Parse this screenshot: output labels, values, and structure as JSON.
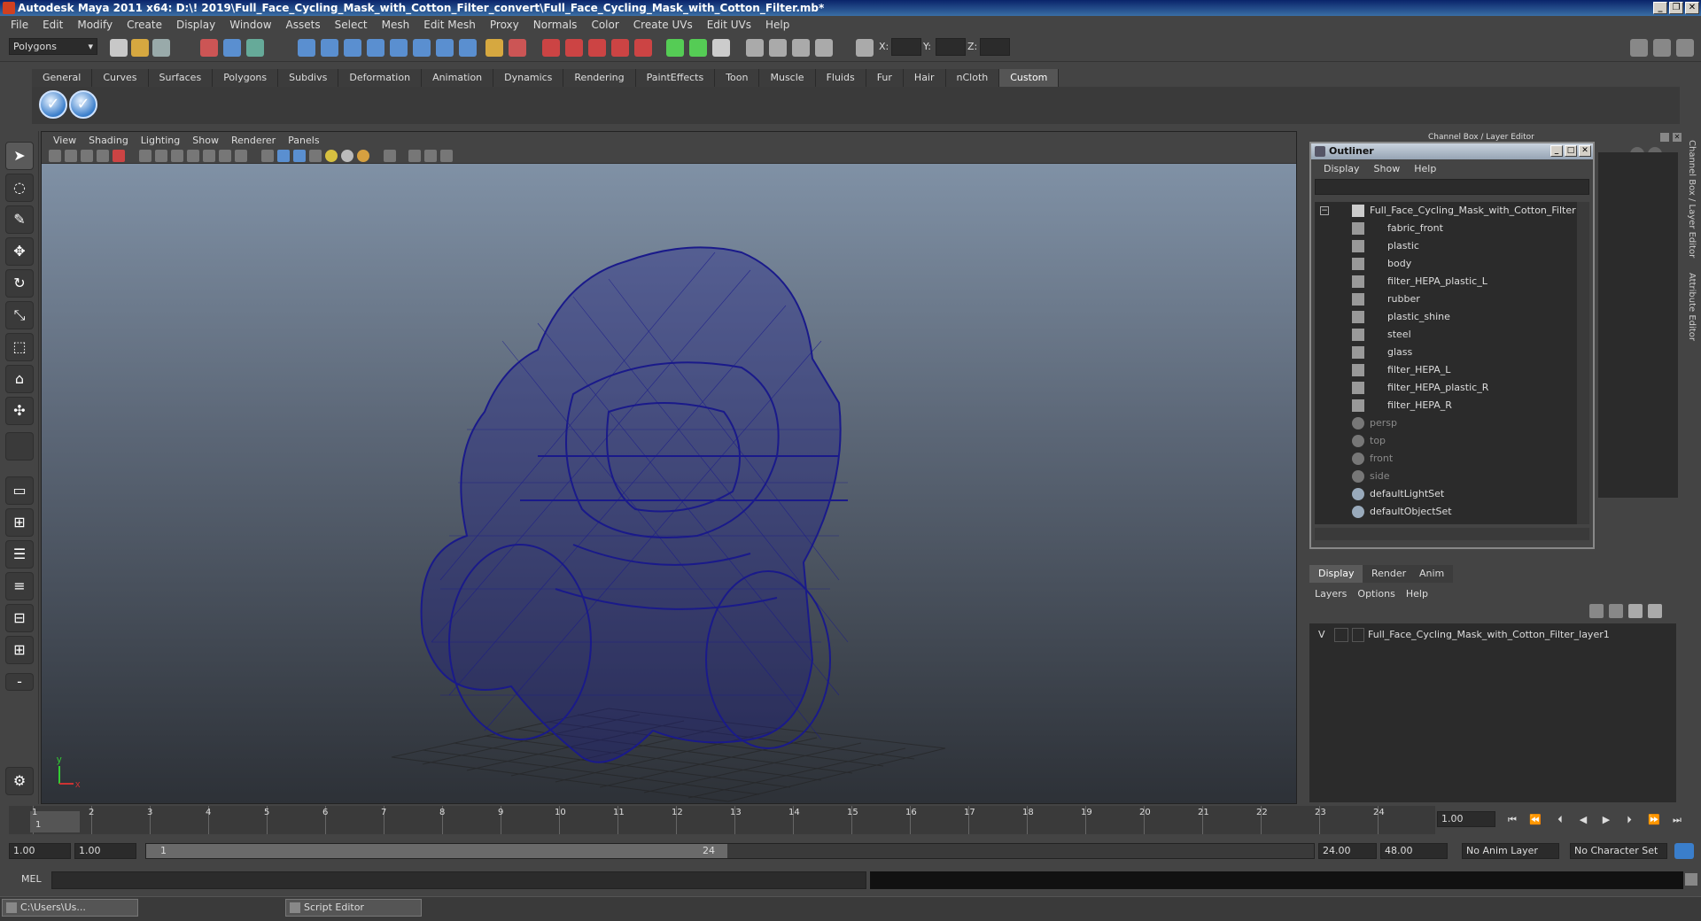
{
  "window": {
    "title": "Autodesk Maya 2011 x64: D:\\! 2019\\Full_Face_Cycling_Mask_with_Cotton_Filter_convert\\Full_Face_Cycling_Mask_with_Cotton_Filter.mb*"
  },
  "menubar": [
    "File",
    "Edit",
    "Modify",
    "Create",
    "Display",
    "Window",
    "Assets",
    "Select",
    "Mesh",
    "Edit Mesh",
    "Proxy",
    "Normals",
    "Color",
    "Create UVs",
    "Edit UVs",
    "Help"
  ],
  "statusline": {
    "mode": "Polygons",
    "x_label": "X:",
    "y_label": "Y:",
    "z_label": "Z:"
  },
  "shelf": {
    "tabs": [
      "General",
      "Curves",
      "Surfaces",
      "Polygons",
      "Subdivs",
      "Deformation",
      "Animation",
      "Dynamics",
      "Rendering",
      "PaintEffects",
      "Toon",
      "Muscle",
      "Fluids",
      "Fur",
      "Hair",
      "nCloth",
      "Custom"
    ],
    "active_tab": "Custom"
  },
  "viewport": {
    "menu": [
      "View",
      "Shading",
      "Lighting",
      "Show",
      "Renderer",
      "Panels"
    ],
    "axis_x": "x",
    "axis_y": "y"
  },
  "channelbox": {
    "title": "Channel Box / Layer Editor",
    "side_tabs": [
      "Channel Box / Layer Editor",
      "Attribute Editor"
    ]
  },
  "outliner": {
    "title": "Outliner",
    "menu": [
      "Display",
      "Show",
      "Help"
    ],
    "root": "Full_Face_Cycling_Mask_with_Cotton_Filter",
    "children": [
      "fabric_front",
      "plastic",
      "body",
      "filter_HEPA_plastic_L",
      "rubber",
      "plastic_shine",
      "steel",
      "glass",
      "filter_HEPA_L",
      "filter_HEPA_plastic_R",
      "filter_HEPA_R"
    ],
    "cameras": [
      "persp",
      "top",
      "front",
      "side"
    ],
    "sets": [
      "defaultLightSet",
      "defaultObjectSet"
    ]
  },
  "layer_editor": {
    "tabs": [
      "Display",
      "Render",
      "Anim"
    ],
    "active_tab": "Display",
    "menu": [
      "Layers",
      "Options",
      "Help"
    ],
    "layer_visible": "V",
    "layer_name": "Full_Face_Cycling_Mask_with_Cotton_Filter_layer1"
  },
  "timeline": {
    "ticks": [
      "1",
      "2",
      "3",
      "4",
      "5",
      "6",
      "7",
      "8",
      "9",
      "10",
      "11",
      "12",
      "13",
      "14",
      "15",
      "16",
      "17",
      "18",
      "19",
      "20",
      "21",
      "22",
      "23",
      "24"
    ],
    "current_frame_marker": "1",
    "current_frame": "1.00"
  },
  "range": {
    "start": "1.00",
    "playback_start": "1.00",
    "slider_start": "1",
    "slider_end": "24",
    "playback_end": "24.00",
    "end": "48.00",
    "anim_layer": "No Anim Layer",
    "character_set": "No Character Set"
  },
  "command": {
    "label": "MEL"
  },
  "taskbar": {
    "item1": "C:\\Users\\Us...",
    "item2": "Script Editor"
  },
  "colors": {
    "wireframe": "#1a1a8a",
    "accent": "#3a7ecb"
  }
}
